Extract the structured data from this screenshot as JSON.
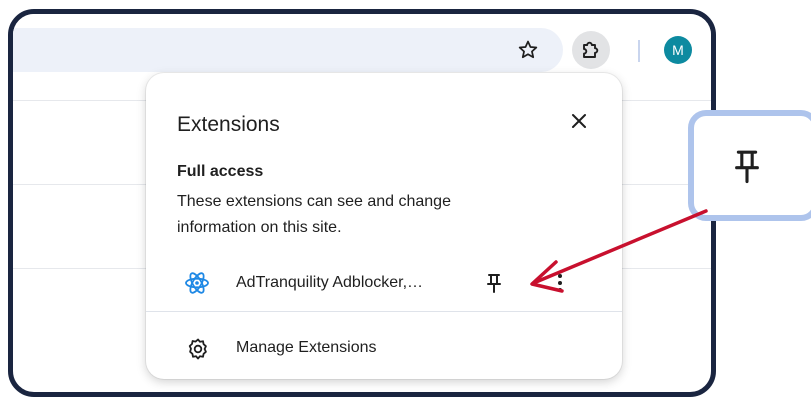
{
  "toolbar": {
    "bookmark_icon": "star-icon",
    "extensions_icon": "puzzle-piece-icon",
    "avatar_initial": "M",
    "avatar_color": "#0d8aa0"
  },
  "popup": {
    "title": "Extensions",
    "close_icon": "close-icon",
    "section": {
      "title": "Full access",
      "description": "These extensions can see and change information on this site."
    },
    "extensions": [
      {
        "name": "AdTranquility Adblocker,…",
        "icon": "adtranquility-atom-icon",
        "pin_icon": "pin-icon",
        "more_icon": "more-vert-icon"
      }
    ],
    "manage": {
      "label": "Manage Extensions",
      "icon": "gear-icon"
    }
  },
  "callout": {
    "icon": "pin-icon"
  },
  "annotation": {
    "arrow_color": "#c8102e"
  }
}
